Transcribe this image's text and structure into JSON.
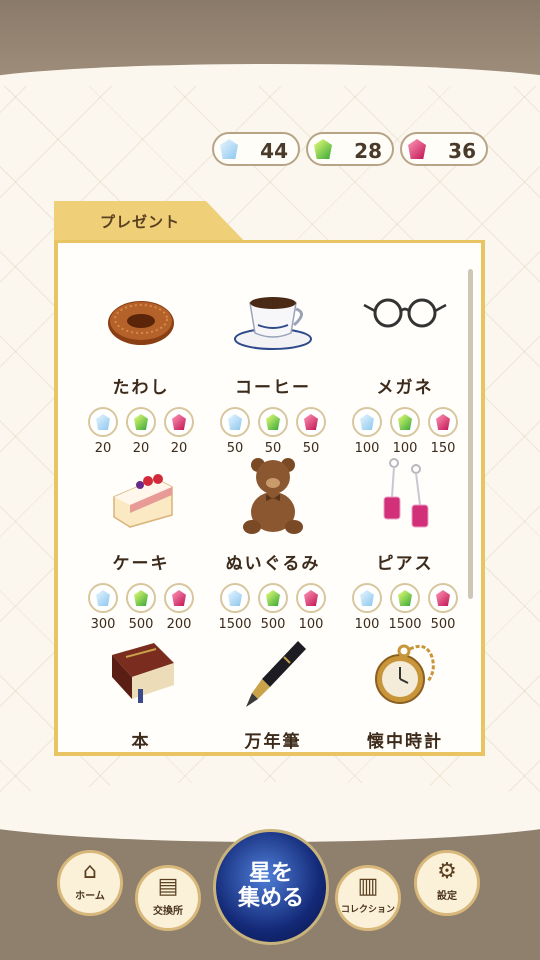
{
  "currencies": [
    {
      "icon": "blue-gem-icon",
      "color": "blue",
      "count": "44"
    },
    {
      "icon": "green-gem-icon",
      "color": "green",
      "count": "28"
    },
    {
      "icon": "red-gem-icon",
      "color": "red",
      "count": "36"
    }
  ],
  "present": {
    "tab_label": "プレゼント",
    "items": [
      {
        "name": "たわし",
        "icon": "scrub-brush-icon",
        "costs": [
          "20",
          "20",
          "20"
        ]
      },
      {
        "name": "コーヒー",
        "icon": "coffee-cup-icon",
        "costs": [
          "50",
          "50",
          "50"
        ]
      },
      {
        "name": "メガネ",
        "icon": "glasses-icon",
        "costs": [
          "100",
          "100",
          "150"
        ]
      },
      {
        "name": "ケーキ",
        "icon": "cake-icon",
        "costs": [
          "300",
          "500",
          "200"
        ]
      },
      {
        "name": "ぬいぐるみ",
        "icon": "teddy-bear-icon",
        "costs": [
          "1500",
          "500",
          "100"
        ]
      },
      {
        "name": "ピアス",
        "icon": "earrings-icon",
        "costs": [
          "100",
          "1500",
          "500"
        ]
      },
      {
        "name": "本",
        "icon": "book-icon",
        "costs": [
          "",
          "",
          ""
        ]
      },
      {
        "name": "万年筆",
        "icon": "fountain-pen-icon",
        "costs": [
          "",
          "",
          ""
        ]
      },
      {
        "name": "懐中時計",
        "icon": "pocket-watch-icon",
        "costs": [
          "",
          "",
          ""
        ]
      }
    ]
  },
  "nav": {
    "home": "ホーム",
    "exchange": "交換所",
    "collect_line1": "星を",
    "collect_line2": "集める",
    "collection": "コレクション",
    "settings": "設定"
  }
}
